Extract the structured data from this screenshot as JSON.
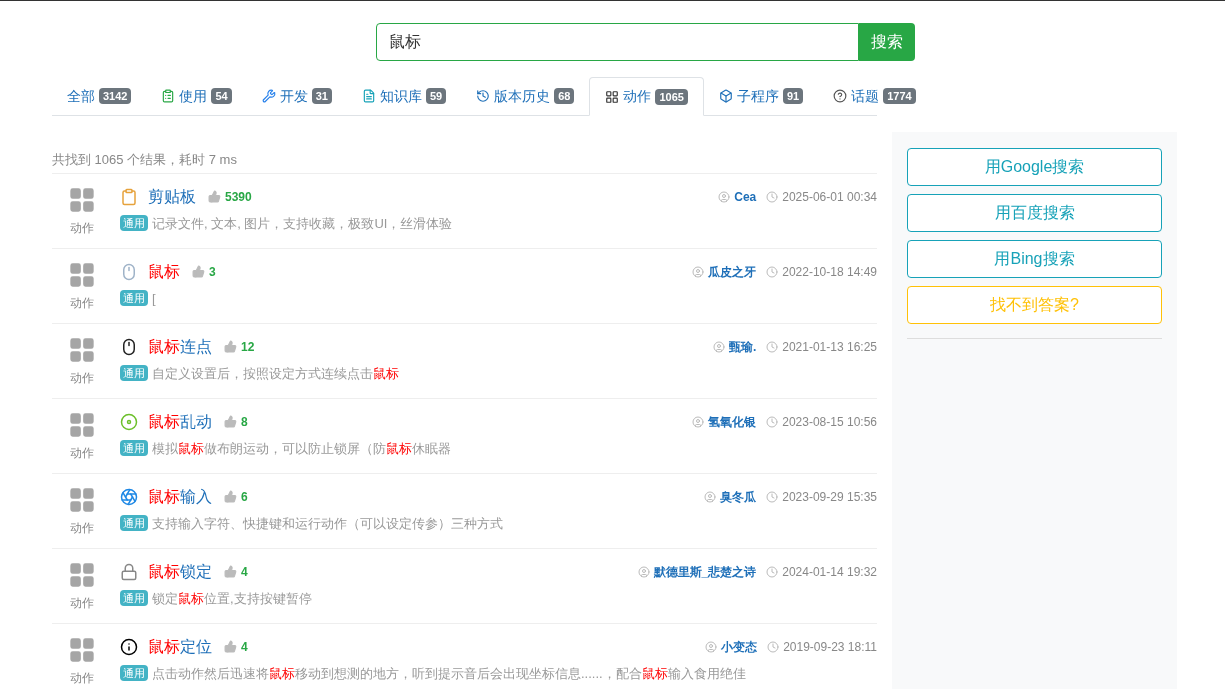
{
  "search": {
    "value": "鼠标",
    "button": "搜索"
  },
  "tabs": [
    {
      "label": "全部",
      "count": "3142",
      "selected": false
    },
    {
      "label": "使用",
      "count": "54",
      "selected": false
    },
    {
      "label": "开发",
      "count": "31",
      "selected": false
    },
    {
      "label": "知识库",
      "count": "59",
      "selected": false
    },
    {
      "label": "版本历史",
      "count": "68",
      "selected": false
    },
    {
      "label": "动作",
      "count": "1065",
      "selected": true
    },
    {
      "label": "子程序",
      "count": "91",
      "selected": false
    },
    {
      "label": "话题",
      "count": "1774",
      "selected": false
    }
  ],
  "summary": "共找到 1065 个结果，耗时 7 ms",
  "results": [
    {
      "type": "动作",
      "title": [
        {
          "text": "剪贴板",
          "highlight": false
        }
      ],
      "likes": "5390",
      "author": "Cea",
      "time": "2025-06-01 00:34",
      "tag": "通用",
      "description": [
        {
          "text": "记录文件, 文本, 图片，支持收藏，极致UI，丝滑体验",
          "highlight": false
        }
      ]
    },
    {
      "type": "动作",
      "title": [
        {
          "text": "鼠标",
          "highlight": true
        }
      ],
      "likes": "3",
      "author": "瓜皮之牙",
      "time": "2022-10-18 14:49",
      "tag": "通用",
      "description": [
        {
          "text": "[",
          "highlight": false
        }
      ]
    },
    {
      "type": "动作",
      "title": [
        {
          "text": "鼠标",
          "highlight": true
        },
        {
          "text": "连点",
          "highlight": false
        }
      ],
      "likes": "12",
      "author": "甄瑜.",
      "time": "2021-01-13 16:25",
      "tag": "通用",
      "description": [
        {
          "text": "自定义设置后，按照设定方式连续点击",
          "highlight": false
        },
        {
          "text": "鼠标",
          "highlight": true
        }
      ]
    },
    {
      "type": "动作",
      "title": [
        {
          "text": "鼠标",
          "highlight": true
        },
        {
          "text": "乱动",
          "highlight": false
        }
      ],
      "likes": "8",
      "author": "氢氧化银",
      "time": "2023-08-15 10:56",
      "tag": "通用",
      "description": [
        {
          "text": "模拟",
          "highlight": false
        },
        {
          "text": "鼠标",
          "highlight": true
        },
        {
          "text": "做布朗运动，可以防止锁屏（防",
          "highlight": false
        },
        {
          "text": "鼠标",
          "highlight": true
        },
        {
          "text": "休眠器",
          "highlight": false
        }
      ]
    },
    {
      "type": "动作",
      "title": [
        {
          "text": "鼠标",
          "highlight": true
        },
        {
          "text": "输入",
          "highlight": false
        }
      ],
      "likes": "6",
      "author": "臭冬瓜",
      "time": "2023-09-29 15:35",
      "tag": "通用",
      "description": [
        {
          "text": "支持输入字符、快捷键和运行动作（可以设定传参）三种方式",
          "highlight": false
        }
      ]
    },
    {
      "type": "动作",
      "title": [
        {
          "text": "鼠标",
          "highlight": true
        },
        {
          "text": "锁定",
          "highlight": false
        }
      ],
      "likes": "4",
      "author": "默德里斯_悲楚之诗",
      "time": "2024-01-14 19:32",
      "tag": "通用",
      "description": [
        {
          "text": "锁定",
          "highlight": false
        },
        {
          "text": "鼠标",
          "highlight": true
        },
        {
          "text": "位置,支持按键暂停",
          "highlight": false
        }
      ]
    },
    {
      "type": "动作",
      "title": [
        {
          "text": "鼠标",
          "highlight": true
        },
        {
          "text": "定位",
          "highlight": false
        }
      ],
      "likes": "4",
      "author": "小变态",
      "time": "2019-09-23 18:11",
      "tag": "通用",
      "description": [
        {
          "text": "点击动作然后迅速将",
          "highlight": false
        },
        {
          "text": "鼠标",
          "highlight": true
        },
        {
          "text": "移动到想测的地方，听到提示音后会出现坐标信息......，配合",
          "highlight": false
        },
        {
          "text": "鼠标",
          "highlight": true
        },
        {
          "text": "输入食用绝佳",
          "highlight": false
        }
      ]
    }
  ],
  "sidebar": [
    {
      "label": "用Google搜索",
      "kind": "info"
    },
    {
      "label": "用百度搜索",
      "kind": "info"
    },
    {
      "label": "用Bing搜索",
      "kind": "info"
    },
    {
      "label": "找不到答案?",
      "kind": "warning"
    }
  ]
}
